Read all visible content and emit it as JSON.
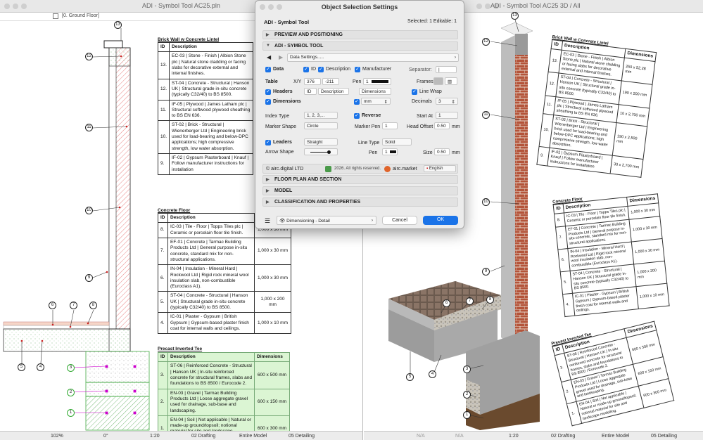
{
  "left_window": {
    "title": "ADI - Symbol Tool AC25.pln",
    "view_name": "[0. Ground Floor]",
    "status": {
      "zoom": "102%",
      "angle": "0°",
      "scale": "1:20",
      "layer": "02 Drafting",
      "model": "Entire Model",
      "detail": "05 Detailing"
    }
  },
  "right_window": {
    "title": "ADI - Symbol Tool AC25 3D / All",
    "status": {
      "na1": "N/A",
      "na2": "N/A",
      "scale": "1:20",
      "layer": "02 Drafting",
      "model": "Entire Model",
      "detail": "05 Detailing"
    }
  },
  "columns": {
    "id": "ID",
    "description": "Description",
    "dimensions": "Dimensions"
  },
  "tables": {
    "lintel": {
      "title": "Brick Wall w Concrete Lintel",
      "rows": [
        {
          "id": "13.",
          "desc": "EC-03 | Stone - Finish | Albion Stone plc | Natural stone cladding or facing slabs for decorative external and internal finishes.",
          "dim": "250 x 52,28 mm"
        },
        {
          "id": "12.",
          "desc": "ST-04 | Concrete - Structural | Hanson UK | Structural grade in-situ concrete (typically C32/40) to BS 8500.",
          "dim": "190 x 200 mm"
        },
        {
          "id": "11.",
          "desc": "IF-05 | Plywood | James Latham plc | Structural softwood plywood sheathing to BS EN 636.",
          "dim": "10 x 2,700 mm"
        },
        {
          "id": "10.",
          "desc": "ST-02 | Brick - Structural | Wienerberger Ltd | Engineering brick used for load-bearing and below-DPC applications; high compressive strength, low water absorption.",
          "dim": "190 x 2,500 mm"
        },
        {
          "id": "9.",
          "desc": "IF-02 | Gypsum Plasterboard | Knauf | Follow manufacturer instructions for installation",
          "dim": "30 x 2,700 mm"
        }
      ]
    },
    "floor": {
      "title": "Concrete Floor",
      "rows": [
        {
          "id": "8.",
          "desc": "IC-03 | Tile - Floor | Topps Tiles plc | Ceramic or porcelain floor tile finish.",
          "dim": "1,000 x 30 mm"
        },
        {
          "id": "7.",
          "desc": "EF-01 | Concrete | Tarmac Building Products Ltd | General purpose in-situ concrete, standard mix for non-structural applications.",
          "dim": "1,000 x 30 mm"
        },
        {
          "id": "6.",
          "desc": "IN-04 | Insulation - Mineral Hard | Rockwool Ltd | Rigid rock mineral wool insulation slab, non-combustible (Euroclass A1).",
          "dim": "1,000 x 30 mm"
        },
        {
          "id": "5.",
          "desc": "ST-04 | Concrete - Structural | Hanson UK | Structural grade in-situ concrete (typically C32/40) to BS 8500.",
          "dim": "1,000 x 200 mm"
        },
        {
          "id": "4.",
          "desc": "IC-01 | Plaster - Gypsum | British Gypsum | Gypsum-based plaster finish coat for internal walls and ceilings.",
          "dim": "1,000 x 10 mm"
        }
      ]
    },
    "tee": {
      "title": "Precast Inverted Tee",
      "rows": [
        {
          "id": "3.",
          "desc": "ST-06 | Reinforced Concrete - Structural | Hanson UK | In-situ reinforced concrete for structural frames, slabs and foundations to BS 8500 / Eurocode 2.",
          "dim": "600 x 500 mm"
        },
        {
          "id": "2.",
          "desc": "EN-03 | Gravel | Tarmac Building Products Ltd | Loose aggregate gravel used for drainage, sub-base and landscaping.",
          "dim": "600 x 150 mm"
        },
        {
          "id": "1.",
          "desc": "EN-04 | Soil | Not applicable | Natural or made-up ground/topsoil; notional material for site and landscape modelling.",
          "dim": "600 x 300 mm"
        }
      ]
    }
  },
  "callouts_left": [
    "13",
    "12",
    "11",
    "10",
    "9",
    "8",
    "7",
    "6",
    "5",
    "4"
  ],
  "callouts_right": [
    "13",
    "12",
    "11",
    "10",
    "9",
    "8",
    "7",
    "6",
    "5",
    "4",
    "3",
    "2",
    "1"
  ],
  "dialog": {
    "title": "Object Selection Settings",
    "object": "ADI - Symbol Tool",
    "selected": "Selected: 1 Editable: 1",
    "sections": {
      "preview": "PREVIEW AND POSITIONING",
      "symbol": "ADI - SYMBOL TOOL",
      "floorplan": "FLOOR PLAN AND SECTION",
      "model": "MODEL",
      "classification": "CLASSIFICATION AND PROPERTIES"
    },
    "data_settings": "Data Settings.....",
    "labels": {
      "data": "Data",
      "id": "ID",
      "description": "Description",
      "manufacturer": "Manufacturer",
      "separator": "Separator:",
      "table": "Table",
      "xy": "X/Y",
      "pen": "Pen",
      "frames": "Frames",
      "headers": "Headers",
      "line_wrap": "Line Wrap",
      "dimensions": "Dimensions",
      "decimals": "Decimals",
      "index_type": "Index Type",
      "reverse": "Reverse",
      "start_at": "Start At",
      "marker_shape": "Marker Shape",
      "marker_pen": "Marker Pen",
      "head_offset": "Head Offset",
      "leaders": "Leaders",
      "line_type": "Line Type",
      "arrow_shape": "Arrow Shape",
      "size": "Size",
      "mm1": "mm",
      "mm2": "mm"
    },
    "values": {
      "separator": "|",
      "x": "376",
      "y": "-211",
      "pen": "1",
      "header_id": "ID",
      "header_desc": "Description",
      "header_dim": "Dimensions",
      "units": "mm",
      "decimals": "3",
      "index_type": "1, 2, 3,...",
      "start_at": "1",
      "marker_shape": "Circle",
      "marker_pen": "1",
      "head_offset": "0.50",
      "leader_type": "Straight",
      "line_type": "Solid",
      "leader_pen": "1",
      "size": "0.50"
    },
    "footer": {
      "airc": "airc.digital LTD",
      "copyright": "2026. All rights reserved.",
      "market": "airc.market",
      "language": "English"
    },
    "favorite": "Dimensioning - Detail",
    "cancel": "Cancel",
    "ok": "OK",
    "accent": "#1a73e8"
  }
}
